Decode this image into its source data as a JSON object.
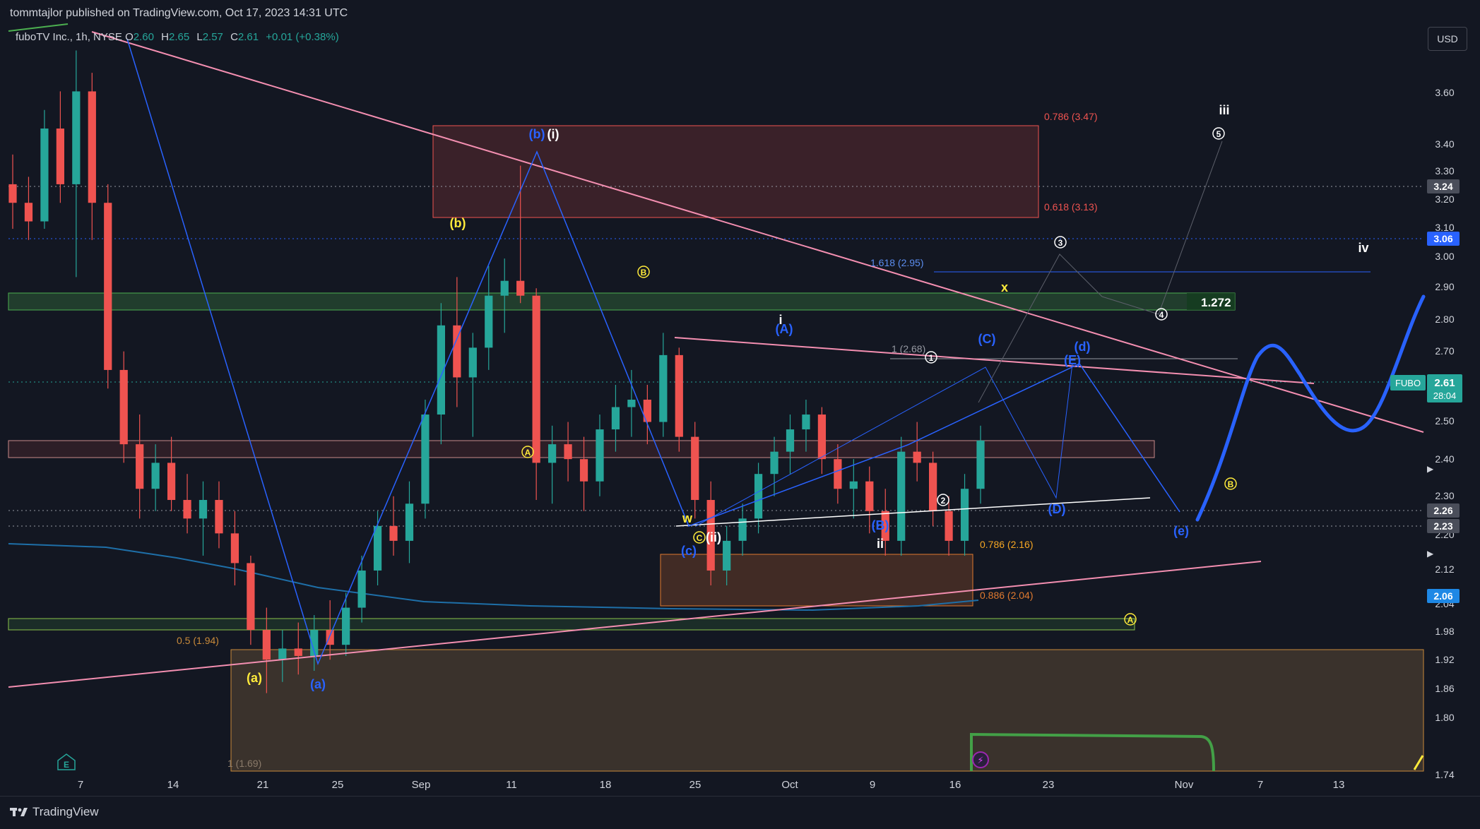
{
  "header": {
    "published": "tommtajlor published on TradingView.com, Oct 17, 2023 14:31 UTC",
    "currency_button": "USD",
    "footer_brand": "TradingView"
  },
  "legend": {
    "name": "fuboTV Inc., 1h, NYSE",
    "o_label": "O",
    "o_value": "2.60",
    "h_label": "H",
    "h_value": "2.65",
    "l_label": "L",
    "l_value": "2.57",
    "c_label": "C",
    "c_value": "2.61",
    "change": "+0.01 (+0.38%)"
  },
  "colors": {
    "background": "#131722",
    "up": "#26a69a",
    "down": "#ef5350",
    "pink_line": "#f48fb1",
    "blue_wave": "#2962ff",
    "yellow_label": "#ffeb3b",
    "green_zone": "#1b5e20",
    "resistance_zone": "#ef5350"
  },
  "chart_data": {
    "type": "candlestick",
    "symbol": "FUBO",
    "interval": "1h",
    "x_tick_labels": [
      "7",
      "14",
      "21",
      "25",
      "Sep",
      "11",
      "18",
      "25",
      "Oct",
      "9",
      "16",
      "23",
      "Nov",
      "7",
      "13"
    ],
    "y_tick_labels": [
      "1.74",
      "1.80",
      "1.86",
      "1.92",
      "1.98",
      "2.04",
      "2.12",
      "2.20",
      "2.30",
      "2.40",
      "2.50",
      "2.60",
      "2.70",
      "2.80",
      "2.90",
      "3.00",
      "3.10",
      "3.20",
      "3.30",
      "3.40",
      "3.60"
    ],
    "ylim": [
      1.72,
      3.72
    ],
    "last_price": "2.61",
    "countdown": "28:04",
    "price_badges": [
      {
        "value": "3.24",
        "style": "grey"
      },
      {
        "value": "3.06",
        "style": "blue"
      },
      {
        "value": "2.26",
        "style": "grey"
      },
      {
        "value": "2.23",
        "style": "grey"
      },
      {
        "value": "2.06",
        "style": "cyan"
      }
    ],
    "fib_labels": [
      {
        "text": "0.786 (3.47)",
        "price": 3.47,
        "color": "#ef5350"
      },
      {
        "text": "0.618 (3.13)",
        "price": 3.13,
        "color": "#ef5350"
      },
      {
        "text": "1.618 (2.95)",
        "price": 2.95,
        "color": "#5b8def"
      },
      {
        "text": "1.272",
        "price": 2.86,
        "color": "#ffffff"
      },
      {
        "text": "1 (2.68)",
        "price": 2.68,
        "color": "#9598a1"
      },
      {
        "text": "0.786 (2.16)",
        "price": 2.16,
        "color": "#f5a623"
      },
      {
        "text": "0.886 (2.04)",
        "price": 2.04,
        "color": "#e07a2f"
      },
      {
        "text": "0.5 (1.94)",
        "price": 1.94,
        "color": "#c98a3a"
      },
      {
        "text": "1 (1.69)",
        "price": 1.69,
        "color": "#8a7a6a"
      }
    ],
    "wave_labels": [
      {
        "text": "(b)",
        "color": "#2962ff"
      },
      {
        "text": "(i)",
        "color": "#ffffff"
      },
      {
        "text": "(b)",
        "color": "#ffeb3b"
      },
      {
        "text": "B",
        "color": "#ffeb3b"
      },
      {
        "text": "A",
        "color": "#ffeb3b"
      },
      {
        "text": "i",
        "color": "#ffffff"
      },
      {
        "text": "(A)",
        "color": "#2962ff"
      },
      {
        "text": "1",
        "color": "#ffffff"
      },
      {
        "text": "(C)",
        "color": "#2962ff"
      },
      {
        "text": "(d)",
        "color": "#2962ff"
      },
      {
        "text": "(E)",
        "color": "#2962ff"
      },
      {
        "text": "x",
        "color": "#ffeb3b"
      },
      {
        "text": "3",
        "color": "#ffffff"
      },
      {
        "text": "4",
        "color": "#ffffff"
      },
      {
        "text": "5",
        "color": "#ffffff"
      },
      {
        "text": "iii",
        "color": "#ffffff"
      },
      {
        "text": "iv",
        "color": "#ffffff"
      },
      {
        "text": "w",
        "color": "#ffeb3b"
      },
      {
        "text": "C",
        "color": "#ffeb3b"
      },
      {
        "text": "(ii)",
        "color": "#ffffff"
      },
      {
        "text": "(c)",
        "color": "#2962ff"
      },
      {
        "text": "(B)",
        "color": "#2962ff"
      },
      {
        "text": "ii",
        "color": "#ffffff"
      },
      {
        "text": "2",
        "color": "#ffffff"
      },
      {
        "text": "(D)",
        "color": "#2962ff"
      },
      {
        "text": "(e)",
        "color": "#2962ff"
      },
      {
        "text": "B",
        "color": "#ffeb3b"
      },
      {
        "text": "A",
        "color": "#ffeb3b"
      },
      {
        "text": "(a)",
        "color": "#ffeb3b"
      },
      {
        "text": "(a)",
        "color": "#2962ff"
      }
    ],
    "candles": [
      {
        "o": 3.3,
        "h": 3.38,
        "l": 3.18,
        "c": 3.25
      },
      {
        "o": 3.25,
        "h": 3.32,
        "l": 3.15,
        "c": 3.2
      },
      {
        "o": 3.2,
        "h": 3.5,
        "l": 3.18,
        "c": 3.45
      },
      {
        "o": 3.45,
        "h": 3.55,
        "l": 3.25,
        "c": 3.3
      },
      {
        "o": 3.3,
        "h": 3.66,
        "l": 3.05,
        "c": 3.55
      },
      {
        "o": 3.55,
        "h": 3.6,
        "l": 3.15,
        "c": 3.25
      },
      {
        "o": 3.25,
        "h": 3.3,
        "l": 2.75,
        "c": 2.8
      },
      {
        "o": 2.8,
        "h": 2.85,
        "l": 2.55,
        "c": 2.6
      },
      {
        "o": 2.6,
        "h": 2.68,
        "l": 2.4,
        "c": 2.48
      },
      {
        "o": 2.48,
        "h": 2.6,
        "l": 2.42,
        "c": 2.55
      },
      {
        "o": 2.55,
        "h": 2.62,
        "l": 2.42,
        "c": 2.45
      },
      {
        "o": 2.45,
        "h": 2.52,
        "l": 2.36,
        "c": 2.4
      },
      {
        "o": 2.4,
        "h": 2.5,
        "l": 2.3,
        "c": 2.45
      },
      {
        "o": 2.45,
        "h": 2.5,
        "l": 2.32,
        "c": 2.36
      },
      {
        "o": 2.36,
        "h": 2.42,
        "l": 2.22,
        "c": 2.28
      },
      {
        "o": 2.28,
        "h": 2.3,
        "l": 2.06,
        "c": 2.1
      },
      {
        "o": 2.1,
        "h": 2.16,
        "l": 1.93,
        "c": 2.02
      },
      {
        "o": 2.02,
        "h": 2.1,
        "l": 1.96,
        "c": 2.05
      },
      {
        "o": 2.05,
        "h": 2.12,
        "l": 1.98,
        "c": 2.03
      },
      {
        "o": 2.03,
        "h": 2.14,
        "l": 1.99,
        "c": 2.1
      },
      {
        "o": 2.1,
        "h": 2.18,
        "l": 2.02,
        "c": 2.06
      },
      {
        "o": 2.06,
        "h": 2.2,
        "l": 2.03,
        "c": 2.16
      },
      {
        "o": 2.16,
        "h": 2.3,
        "l": 2.12,
        "c": 2.26
      },
      {
        "o": 2.26,
        "h": 2.42,
        "l": 2.22,
        "c": 2.38
      },
      {
        "o": 2.38,
        "h": 2.46,
        "l": 2.3,
        "c": 2.34
      },
      {
        "o": 2.34,
        "h": 2.5,
        "l": 2.28,
        "c": 2.44
      },
      {
        "o": 2.44,
        "h": 2.72,
        "l": 2.4,
        "c": 2.68
      },
      {
        "o": 2.68,
        "h": 2.98,
        "l": 2.6,
        "c": 2.92
      },
      {
        "o": 2.92,
        "h": 3.05,
        "l": 2.7,
        "c": 2.78
      },
      {
        "o": 2.78,
        "h": 2.9,
        "l": 2.62,
        "c": 2.86
      },
      {
        "o": 2.86,
        "h": 3.08,
        "l": 2.8,
        "c": 3.0
      },
      {
        "o": 3.0,
        "h": 3.1,
        "l": 2.9,
        "c": 3.04
      },
      {
        "o": 3.04,
        "h": 3.35,
        "l": 2.98,
        "c": 3.0
      },
      {
        "o": 3.0,
        "h": 3.02,
        "l": 2.45,
        "c": 2.55
      },
      {
        "o": 2.55,
        "h": 2.65,
        "l": 2.44,
        "c": 2.6
      },
      {
        "o": 2.6,
        "h": 2.66,
        "l": 2.5,
        "c": 2.56
      },
      {
        "o": 2.56,
        "h": 2.62,
        "l": 2.42,
        "c": 2.5
      },
      {
        "o": 2.5,
        "h": 2.68,
        "l": 2.46,
        "c": 2.64
      },
      {
        "o": 2.64,
        "h": 2.76,
        "l": 2.58,
        "c": 2.7
      },
      {
        "o": 2.7,
        "h": 2.8,
        "l": 2.62,
        "c": 2.72
      },
      {
        "o": 2.72,
        "h": 2.76,
        "l": 2.6,
        "c": 2.66
      },
      {
        "o": 2.66,
        "h": 2.9,
        "l": 2.62,
        "c": 2.84
      },
      {
        "o": 2.84,
        "h": 2.86,
        "l": 2.58,
        "c": 2.62
      },
      {
        "o": 2.62,
        "h": 2.66,
        "l": 2.4,
        "c": 2.45
      },
      {
        "o": 2.45,
        "h": 2.5,
        "l": 2.22,
        "c": 2.26
      },
      {
        "o": 2.26,
        "h": 2.38,
        "l": 2.22,
        "c": 2.34
      },
      {
        "o": 2.34,
        "h": 2.44,
        "l": 2.3,
        "c": 2.4
      },
      {
        "o": 2.4,
        "h": 2.55,
        "l": 2.36,
        "c": 2.52
      },
      {
        "o": 2.52,
        "h": 2.62,
        "l": 2.46,
        "c": 2.58
      },
      {
        "o": 2.58,
        "h": 2.68,
        "l": 2.52,
        "c": 2.64
      },
      {
        "o": 2.64,
        "h": 2.72,
        "l": 2.58,
        "c": 2.68
      },
      {
        "o": 2.68,
        "h": 2.7,
        "l": 2.52,
        "c": 2.56
      },
      {
        "o": 2.56,
        "h": 2.6,
        "l": 2.44,
        "c": 2.48
      },
      {
        "o": 2.48,
        "h": 2.56,
        "l": 2.4,
        "c": 2.5
      },
      {
        "o": 2.5,
        "h": 2.54,
        "l": 2.36,
        "c": 2.42
      },
      {
        "o": 2.42,
        "h": 2.48,
        "l": 2.3,
        "c": 2.34
      },
      {
        "o": 2.34,
        "h": 2.62,
        "l": 2.3,
        "c": 2.58
      },
      {
        "o": 2.58,
        "h": 2.66,
        "l": 2.5,
        "c": 2.55
      },
      {
        "o": 2.55,
        "h": 2.58,
        "l": 2.38,
        "c": 2.42
      },
      {
        "o": 2.42,
        "h": 2.46,
        "l": 2.3,
        "c": 2.34
      },
      {
        "o": 2.34,
        "h": 2.52,
        "l": 2.3,
        "c": 2.48
      },
      {
        "o": 2.48,
        "h": 2.65,
        "l": 2.44,
        "c": 2.61
      }
    ],
    "projection": "blue curved projection path after last candle"
  },
  "axis": {
    "fubo_label": "FUBO"
  }
}
